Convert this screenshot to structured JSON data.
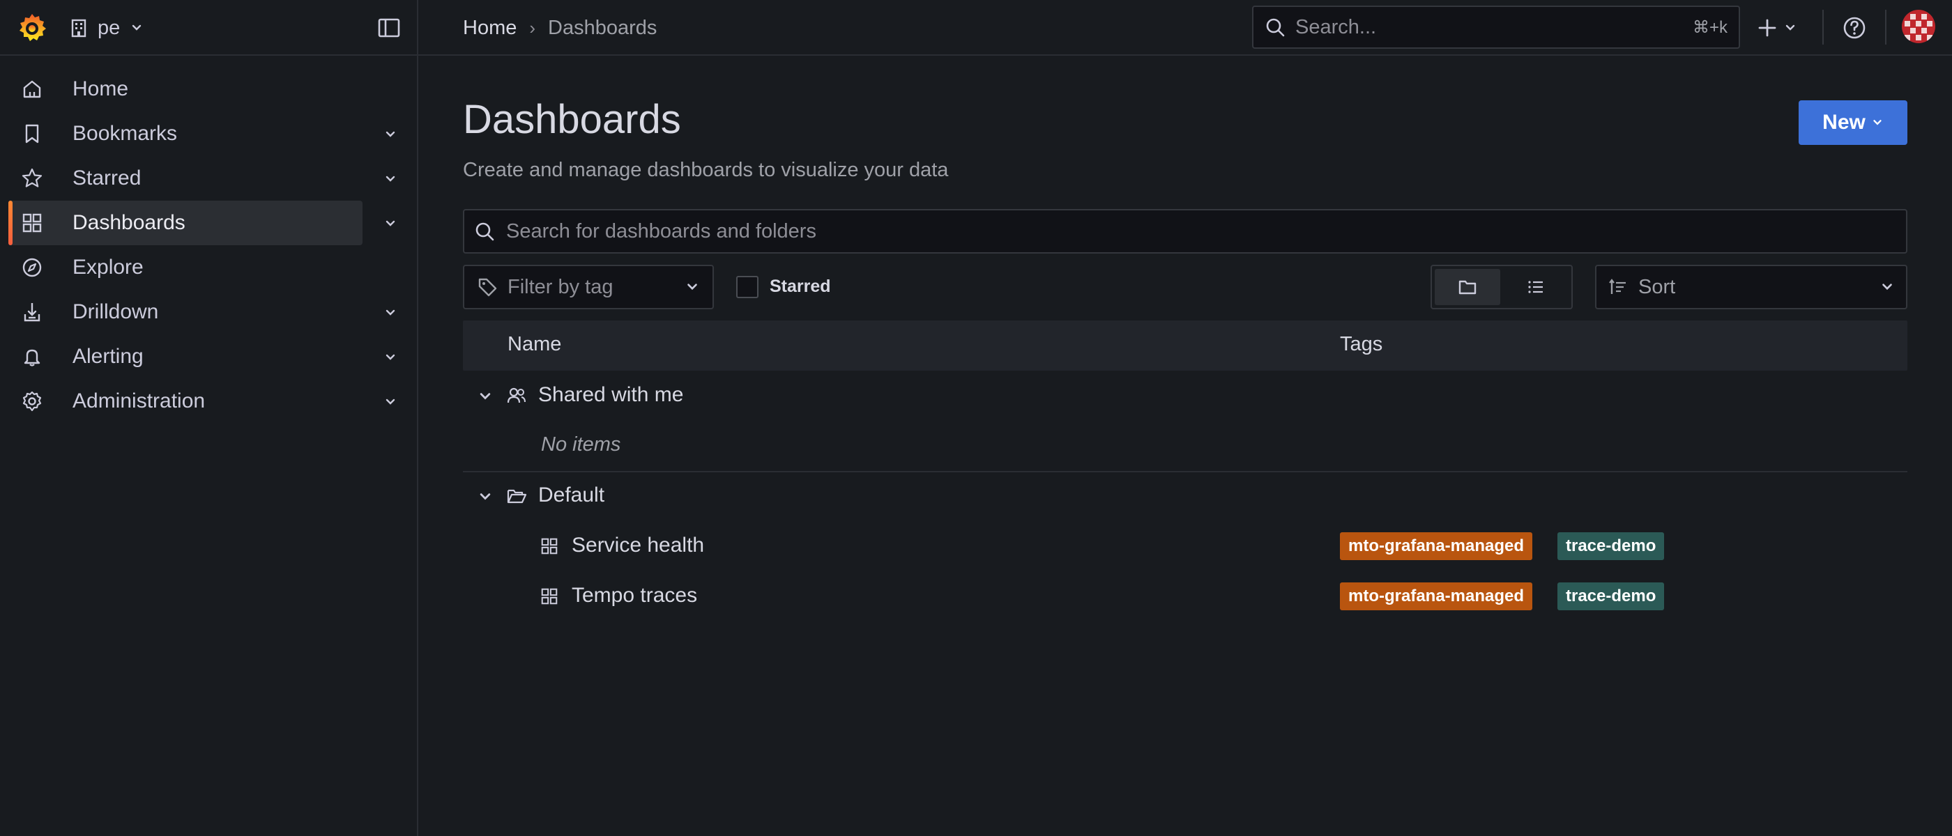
{
  "org": {
    "name": "pe"
  },
  "breadcrumb": {
    "home": "Home",
    "separator": "›",
    "current": "Dashboards"
  },
  "top_search": {
    "placeholder": "Search...",
    "shortcut": "⌘+k"
  },
  "sidebar": {
    "items": [
      {
        "label": "Home",
        "icon": "home-icon",
        "has_chevron": false,
        "active": false
      },
      {
        "label": "Bookmarks",
        "icon": "bookmark-icon",
        "has_chevron": true,
        "active": false
      },
      {
        "label": "Starred",
        "icon": "star-icon",
        "has_chevron": true,
        "active": false
      },
      {
        "label": "Dashboards",
        "icon": "apps-icon",
        "has_chevron": true,
        "active": true
      },
      {
        "label": "Explore",
        "icon": "compass-icon",
        "has_chevron": false,
        "active": false
      },
      {
        "label": "Drilldown",
        "icon": "drilldown-icon",
        "has_chevron": true,
        "active": false
      },
      {
        "label": "Alerting",
        "icon": "bell-icon",
        "has_chevron": true,
        "active": false
      },
      {
        "label": "Administration",
        "icon": "cog-icon",
        "has_chevron": true,
        "active": false
      }
    ]
  },
  "page": {
    "title": "Dashboards",
    "subtitle": "Create and manage dashboards to visualize your data",
    "new_button": "New"
  },
  "filters": {
    "search_placeholder": "Search for dashboards and folders",
    "tag_placeholder": "Filter by tag",
    "starred_label": "Starred",
    "starred_checked": false,
    "sort_placeholder": "Sort",
    "view_mode": "folder"
  },
  "table": {
    "columns": [
      "Name",
      "Tags"
    ],
    "groups": [
      {
        "name": "Shared with me",
        "icon": "users-icon",
        "empty_text": "No items",
        "dashboards": []
      },
      {
        "name": "Default",
        "icon": "folder-open-icon",
        "dashboards": [
          {
            "name": "Service health",
            "tags": [
              "mto-grafana-managed",
              "trace-demo"
            ]
          },
          {
            "name": "Tempo traces",
            "tags": [
              "mto-grafana-managed",
              "trace-demo"
            ]
          }
        ]
      }
    ]
  },
  "colors": {
    "background": "#181b1f",
    "accent": "#3d71d9",
    "brand_orange": "#f55f3e",
    "tag_orange": "#b9550f",
    "tag_teal": "#2b5a56"
  }
}
